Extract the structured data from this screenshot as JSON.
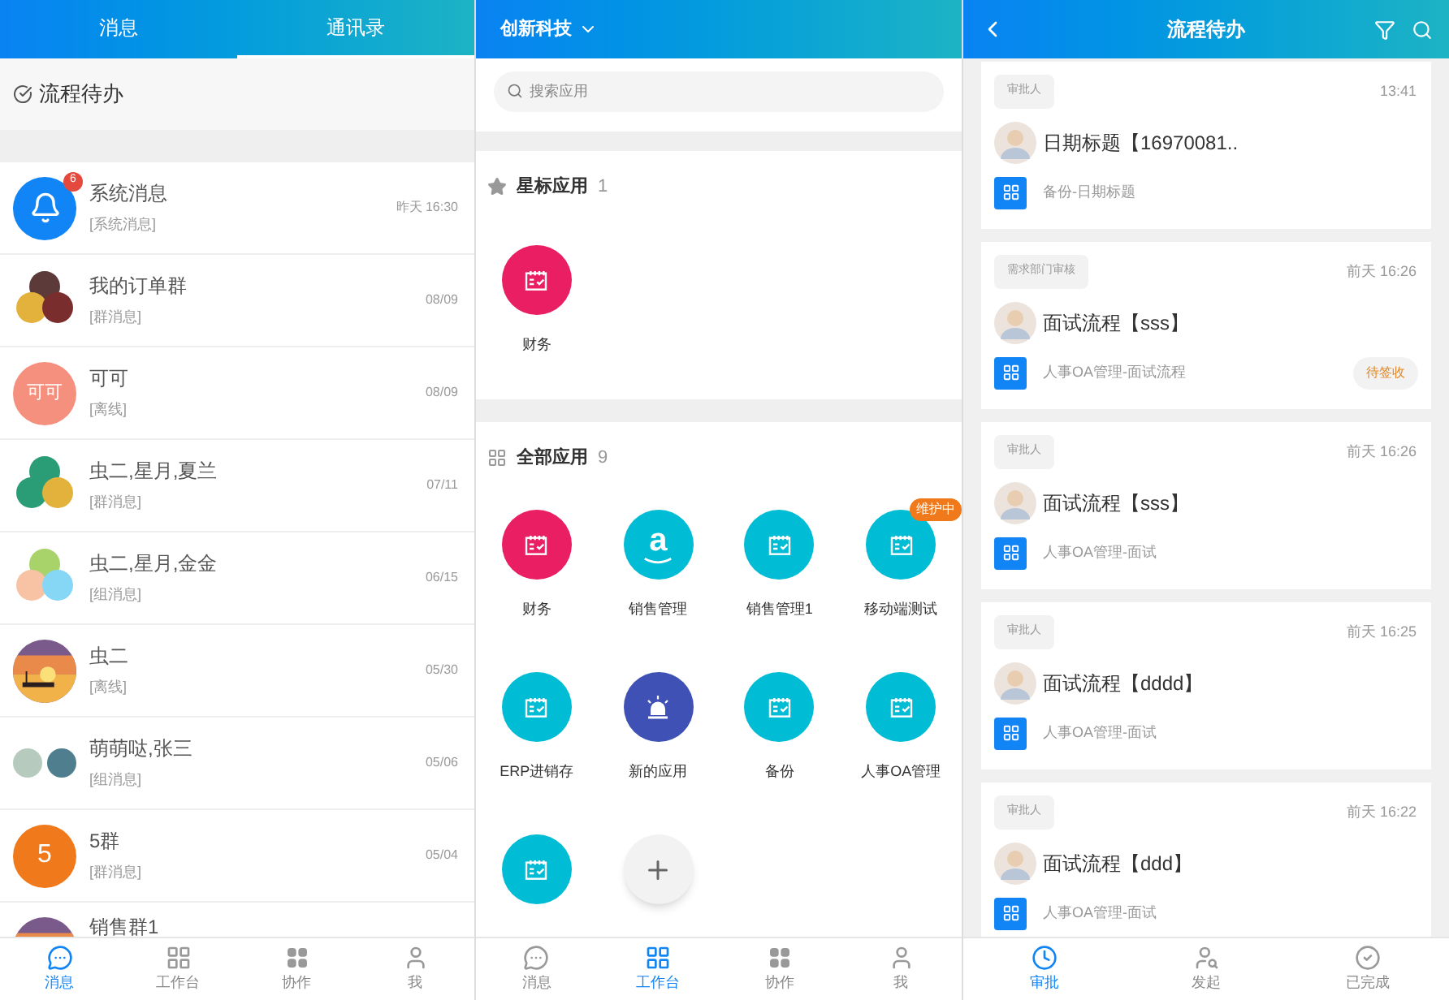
{
  "messages_screen": {
    "tabs": [
      {
        "label": "消息",
        "selected": false
      },
      {
        "label": "通讯录",
        "selected": true
      }
    ],
    "todo_entry": "流程待办",
    "chats": [
      {
        "name": "系统消息",
        "sub": "[系统消息]",
        "time": "昨天 16:30",
        "badge": "6",
        "avatar": {
          "kind": "bell",
          "color": "#1185f5"
        }
      },
      {
        "name": "我的订单群",
        "sub": "[群消息]",
        "time": "08/09",
        "avatar": {
          "kind": "group",
          "members": [
            {
              "color": "#5c3a3a"
            },
            {
              "color": "#e3b23c"
            },
            {
              "color": "#7a2d2d"
            }
          ]
        }
      },
      {
        "name": "可可",
        "sub": "[离线]",
        "time": "08/09",
        "avatar": {
          "kind": "text",
          "text": "可可",
          "color": "#f6907e"
        }
      },
      {
        "name": "虫二,星月,夏兰",
        "sub": "[群消息]",
        "time": "07/11",
        "avatar": {
          "kind": "group",
          "members": [
            {
              "color": "#2a9d77"
            },
            {
              "color": "#2a9d77"
            },
            {
              "color": "#e3b23c"
            }
          ]
        }
      },
      {
        "name": "虫二,星月,金金",
        "sub": "[组消息]",
        "time": "06/15",
        "avatar": {
          "kind": "group",
          "members": [
            {
              "color": "#a8d26a"
            },
            {
              "color": "#f7c3a4"
            },
            {
              "color": "#86d6f5"
            }
          ]
        }
      },
      {
        "name": "虫二",
        "sub": "[离线]",
        "time": "05/30"
      },
      {
        "name": "萌萌哒,张三",
        "sub": "[组消息]",
        "time": "05/06",
        "avatar": {
          "kind": "pair",
          "members": [
            {
              "color": "#b6cbbd"
            },
            {
              "color": "#4f7f8e"
            }
          ]
        }
      },
      {
        "name": "5群",
        "sub": "[群消息]",
        "time": "05/04",
        "avatar": {
          "kind": "text",
          "text": "5",
          "color": "#f07a1b"
        }
      },
      {
        "name": "销售群1"
      }
    ],
    "nav": [
      {
        "label": "消息",
        "selected": true
      },
      {
        "label": "工作台",
        "selected": false
      },
      {
        "label": "协作",
        "selected": false
      },
      {
        "label": "我",
        "selected": false
      }
    ]
  },
  "workbench_screen": {
    "org": "创新科技",
    "search": {
      "placeholder": "搜索应用"
    },
    "starred": {
      "title": "星标应用",
      "count": "1",
      "apps": [
        {
          "label": "财务",
          "kind": "calendar",
          "color": "#e91e63"
        }
      ]
    },
    "all": {
      "title": "全部应用",
      "count": "9",
      "apps": [
        {
          "label": "财务",
          "kind": "calendar",
          "color": "#e91e63"
        },
        {
          "label": "销售管理",
          "kind": "letter",
          "glyph": "a",
          "color": "#00bcd4"
        },
        {
          "label": "销售管理1",
          "kind": "calendar",
          "color": "#00bcd4"
        },
        {
          "label": "移动端测试",
          "kind": "calendar",
          "color": "#00bcd4",
          "badge": "维护中"
        },
        {
          "label": "ERP进销存",
          "kind": "calendar",
          "color": "#00bcd4"
        },
        {
          "label": "新的应用",
          "kind": "alarm",
          "color": "#3f51b5"
        },
        {
          "label": "备份",
          "kind": "calendar",
          "color": "#00bcd4"
        },
        {
          "label": "人事OA管理",
          "kind": "calendar",
          "color": "#00bcd4"
        },
        {
          "kind": "calendar",
          "color": "#00bcd4"
        },
        {
          "kind": "add",
          "color": "#f2f2f2"
        }
      ]
    },
    "nav": [
      {
        "label": "消息",
        "selected": false
      },
      {
        "label": "工作台",
        "selected": true
      },
      {
        "label": "协作",
        "selected": false
      },
      {
        "label": "我",
        "selected": false
      }
    ]
  },
  "todo_screen": {
    "title": "流程待办",
    "items": [
      {
        "tag": "审批人",
        "time": "13:41",
        "title": "日期标题【16970081..",
        "app": "备份-日期标题"
      },
      {
        "tag": "需求部门审核",
        "time": "前天 16:26",
        "title": "面试流程【sss】",
        "app": "人事OA管理-面试流程",
        "status": "待签收"
      },
      {
        "tag": "审批人",
        "time": "前天 16:26",
        "title": "面试流程【sss】",
        "app": "人事OA管理-面试"
      },
      {
        "tag": "审批人",
        "time": "前天 16:25",
        "title": "面试流程【dddd】",
        "app": "人事OA管理-面试"
      },
      {
        "tag": "审批人",
        "time": "前天 16:22",
        "title": "面试流程【ddd】",
        "app": "人事OA管理-面试"
      }
    ],
    "nav": [
      {
        "label": "审批",
        "selected": true
      },
      {
        "label": "发起",
        "selected": false
      },
      {
        "label": "已完成",
        "selected": false
      }
    ]
  }
}
